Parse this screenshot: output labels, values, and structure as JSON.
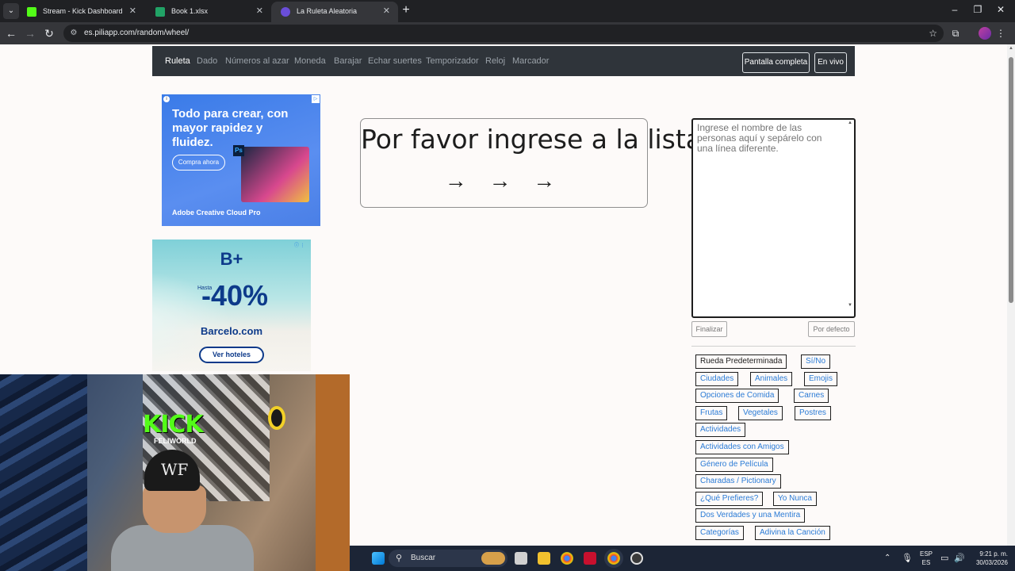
{
  "browser": {
    "tabs": [
      {
        "title": "Stream - Kick Dashboard",
        "favicon": "kick-icon",
        "color": "#53fc18",
        "active": false
      },
      {
        "title": "Book 1.xlsx",
        "favicon": "excel-icon",
        "color": "#21a366",
        "active": false
      },
      {
        "title": "La Ruleta Aleatoria",
        "favicon": "piliapp-icon",
        "color": "#6a4ed9",
        "active": true
      }
    ],
    "url": "es.piliapp.com/random/wheel/"
  },
  "sitenav": {
    "links": [
      "Ruleta",
      "Dado",
      "Números al azar",
      "Moneda",
      "Barajar",
      "Echar suertes",
      "Temporizador",
      "Reloj",
      "Marcador"
    ],
    "fullscreen_label": "Pantalla completa",
    "live_label": "En vivo"
  },
  "ad1": {
    "headline": "Todo para crear, con mayor rapidez y fluidez.",
    "cta": "Compra ahora",
    "brand": "Adobe Creative Cloud Pro",
    "ps_label": "Ps"
  },
  "ad2": {
    "logo": "B+",
    "hasta": "Hasta",
    "discount": "-40%",
    "site": "Barcelo.com",
    "button": "Ver hoteles"
  },
  "wheel": {
    "message": "Por favor ingrese a la lista",
    "arrows": "→ → →"
  },
  "names_input": {
    "placeholder": "Ingrese el nombre de las personas aquí y sepárelo con una línea diferente.",
    "finish_label": "Finalizar",
    "default_label": "Por defecto"
  },
  "presets": [
    "Rueda Predeterminada",
    "Sí/No",
    "Ciudades",
    "Animales",
    "Emojis",
    "Opciones de Comida",
    "Carnes",
    "Frutas",
    "Vegetales",
    "Postres",
    "Actividades",
    "Actividades con Amigos",
    "Género de Película",
    "Charadas / Pictionary",
    "¿Qué Prefieres?",
    "Yo Nunca",
    "Dos Verdades y una Mentira",
    "Categorías",
    "Adivina la Canción"
  ],
  "webcam": {
    "overlay_brand": "KICK",
    "overlay_name": "FELIWORLD",
    "cap_logo": "WF"
  },
  "taskbar": {
    "search_label": "Buscar",
    "lang_top": "ESP",
    "lang_bottom": "ES",
    "time": "9:21 p. m.",
    "date": "30/03/2026"
  }
}
